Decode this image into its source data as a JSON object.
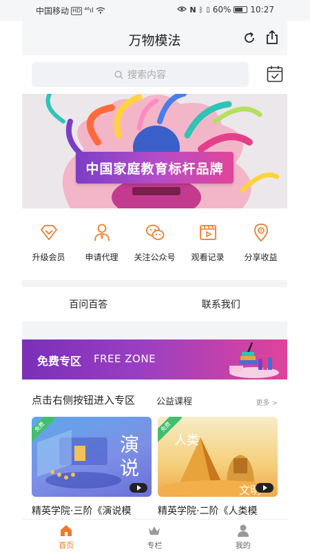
{
  "status_bar": {
    "carrier": "中国移动",
    "hd": "HD",
    "signal": "⁴⁶ıl",
    "battery_pct": "60%",
    "time": "10:27"
  },
  "header": {
    "title": "万物模法"
  },
  "search": {
    "placeholder": "搜索内容"
  },
  "banner": {
    "label": "中国家庭教育标杆品牌"
  },
  "quick_menu": [
    {
      "label": "升级会员",
      "icon": "diamond-icon"
    },
    {
      "label": "申请代理",
      "icon": "agent-icon"
    },
    {
      "label": "关注公众号",
      "icon": "wechat-icon"
    },
    {
      "label": "观看记录",
      "icon": "video-history-icon"
    },
    {
      "label": "分享收益",
      "icon": "share-income-icon"
    }
  ],
  "links": {
    "faq": "百问百答",
    "contact": "联系我们"
  },
  "free_zone": {
    "cn": "免费专区",
    "en": "FREE ZONE"
  },
  "section": {
    "hint": "点击右侧按钮进入专区",
    "category": "公益课程",
    "more": "更多 >"
  },
  "cards": [
    {
      "tag": "免费",
      "title": "精英学院·三阶《演说模",
      "art_text": "演说"
    },
    {
      "tag": "免费",
      "title": "精英学院·二阶《人类模",
      "art_text": "人类 文明"
    }
  ],
  "tabs": [
    {
      "label": "首页",
      "icon": "home-icon",
      "active": true
    },
    {
      "label": "专栏",
      "icon": "crown-icon",
      "active": false
    },
    {
      "label": "我的",
      "icon": "user-icon",
      "active": false
    }
  ],
  "colors": {
    "accent": "#f07a2a",
    "free_zone_start": "#7a2fb9",
    "free_zone_end": "#e0439a"
  }
}
